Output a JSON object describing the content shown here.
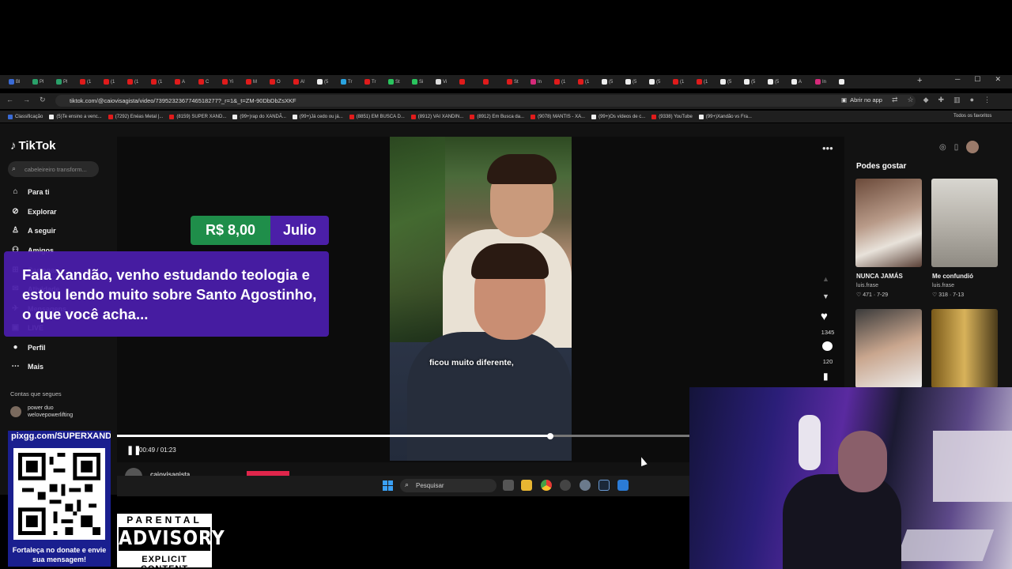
{
  "browser": {
    "tabs": [
      {
        "label": "Bl",
        "color": "#3a6bd6"
      },
      {
        "label": "Pl",
        "color": "#2aa16a"
      },
      {
        "label": "Pl",
        "color": "#2aa16a"
      },
      {
        "label": "(1",
        "color": "#e01b1b"
      },
      {
        "label": "(1",
        "color": "#e01b1b"
      },
      {
        "label": "(1",
        "color": "#e01b1b"
      },
      {
        "label": "(1",
        "color": "#e01b1b"
      },
      {
        "label": "A",
        "color": "#e01b1b"
      },
      {
        "label": "C",
        "color": "#e01b1b"
      },
      {
        "label": "Yi",
        "color": "#e01b1b"
      },
      {
        "label": "M",
        "color": "#e01b1b"
      },
      {
        "label": "O",
        "color": "#e01b1b"
      },
      {
        "label": "A!",
        "color": "#e01b1b"
      },
      {
        "label": "(5",
        "color": "#eeeeee"
      },
      {
        "label": "Tr",
        "color": "#2aa3e0"
      },
      {
        "label": "Tr",
        "color": "#e01b1b"
      },
      {
        "label": "St",
        "color": "#2ac45e"
      },
      {
        "label": "Si",
        "color": "#2ac45e"
      },
      {
        "label": "Vi",
        "color": "#dddddd"
      },
      {
        "label": "",
        "color": "#e01b1b"
      },
      {
        "label": "",
        "color": "#e01b1b"
      },
      {
        "label": "St",
        "color": "#e01b1b"
      },
      {
        "label": "In",
        "color": "#d62a7a"
      },
      {
        "label": "(1",
        "color": "#e01b1b"
      },
      {
        "label": "(1",
        "color": "#e01b1b"
      },
      {
        "label": "(5",
        "color": "#eeeeee"
      },
      {
        "label": "(5",
        "color": "#eeeeee"
      },
      {
        "label": "(5",
        "color": "#eeeeee"
      },
      {
        "label": "(1",
        "color": "#e01b1b"
      },
      {
        "label": "(1",
        "color": "#e01b1b"
      },
      {
        "label": "(5",
        "color": "#eeeeee"
      },
      {
        "label": "(5",
        "color": "#eeeeee"
      },
      {
        "label": "(5",
        "color": "#eeeeee"
      },
      {
        "label": "A",
        "color": "#eeeeee"
      },
      {
        "label": "In",
        "color": "#d62a7a"
      },
      {
        "label": "",
        "color": "#eeeeee"
      }
    ],
    "url": "tiktok.com/@caiovisagista/video/7395232367746518277?_r=1&_t=ZM-90DbDbZsXKF",
    "open_app_label": "Abrir no app",
    "bookmarks": [
      {
        "label": "Classificação",
        "color": "#3a6bd6"
      },
      {
        "label": "(5)Te ensino a venc...",
        "color": "#eeeeee"
      },
      {
        "label": "(7292) Enéas Metal |...",
        "color": "#e01b1b"
      },
      {
        "label": "(8159) SUPER XAND...",
        "color": "#e01b1b"
      },
      {
        "label": "(99+)rap do XANDÃ...",
        "color": "#eeeeee"
      },
      {
        "label": "(99+)Já cedo ou já...",
        "color": "#eeeeee"
      },
      {
        "label": "(8851) EM BUSCA D...",
        "color": "#e01b1b"
      },
      {
        "label": "(8912) VAI XANDIN...",
        "color": "#e01b1b"
      },
      {
        "label": "(8912) Em Busca da...",
        "color": "#e01b1b"
      },
      {
        "label": "(9078) MANTIS - XA...",
        "color": "#e01b1b"
      },
      {
        "label": "(99+)Os vídeos de c...",
        "color": "#eeeeee"
      },
      {
        "label": "(9338) YouTube",
        "color": "#e01b1b"
      },
      {
        "label": "(99+)Xandão vs Fra...",
        "color": "#eeeeee"
      }
    ],
    "all_favorites": "Todos os favoritos"
  },
  "tiktok": {
    "logo": "TikTok",
    "search_placeholder": "cabeleireiro transform...",
    "nav": [
      {
        "label": "Para ti",
        "icon": "home-icon"
      },
      {
        "label": "Explorar",
        "icon": "compass-icon"
      },
      {
        "label": "A seguir",
        "icon": "following-icon"
      },
      {
        "label": "Amigos",
        "icon": "friends-icon"
      },
      {
        "label": "Carregar",
        "icon": "upload-icon"
      },
      {
        "label": "Atividade",
        "icon": "activity-icon"
      },
      {
        "label": "Mensagens",
        "icon": "messages-icon"
      },
      {
        "label": "LIVE",
        "icon": "live-icon"
      },
      {
        "label": "Perfil",
        "icon": "profile-icon"
      },
      {
        "label": "Mais",
        "icon": "more-icon"
      }
    ],
    "following_heading": "Contas que segues",
    "following_account": {
      "line1": "power duo",
      "line2": "welovepowerlifting"
    },
    "video": {
      "subtitle": "ficou muito diferente,",
      "likes": "1345",
      "comments": "120",
      "current_time": "00:49",
      "duration": "01:23",
      "time_display": "00:49 / 01:23",
      "progress": 0.757,
      "author": "caiovisagista"
    },
    "suggestions_heading": "Podes gostar",
    "suggestions": [
      {
        "title": "NUNCA JAMÁS",
        "user": "luis.frase",
        "meta": "♡ 471 · 7-29"
      },
      {
        "title": "Me confundió",
        "user": "luis.frase",
        "meta": "♡ 318 · 7-13"
      }
    ]
  },
  "taskbar": {
    "search_placeholder": "Pesquisar"
  },
  "overlay": {
    "donation_amount": "R$ 8,00",
    "donation_name": "Julio",
    "donation_message": "Fala Xandão, venho estudando teologia e estou lendo muito sobre Santo Agostinho, o que você acha...",
    "qr_url": "pixgg.com/SUPERXANDAO",
    "qr_caption": "Fortaleça no donate e envie sua mensagem!",
    "parental": "PARENTAL",
    "advisory": "ADVISORY",
    "explicit": "EXPLICIT CONTENT"
  }
}
